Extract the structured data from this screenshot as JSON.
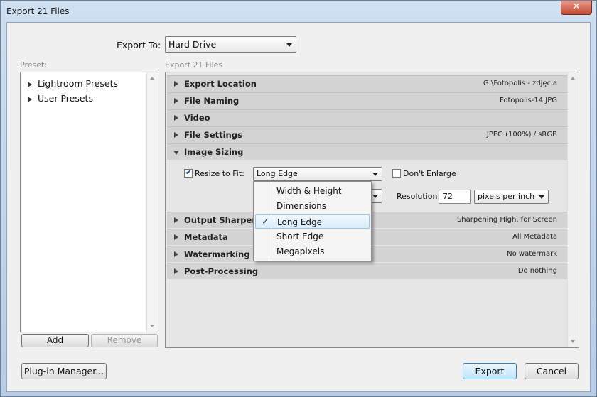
{
  "window": {
    "title": "Export 21 Files",
    "close_glyph": "✕"
  },
  "export_to": {
    "label": "Export To:",
    "value": "Hard Drive"
  },
  "preset": {
    "label": "Preset:",
    "items": [
      {
        "label": "Lightroom Presets"
      },
      {
        "label": "User Presets"
      }
    ],
    "add_label": "Add",
    "remove_label": "Remove"
  },
  "files_header": "Export 21 Files",
  "sections": [
    {
      "name": "Export Location",
      "summary": "G:\\Fotopolis - zdjęcia"
    },
    {
      "name": "File Naming",
      "summary": "Fotopolis-14.JPG"
    },
    {
      "name": "Video",
      "summary": ""
    },
    {
      "name": "File Settings",
      "summary": "JPEG (100%) / sRGB"
    },
    {
      "name": "Image Sizing",
      "summary": ""
    },
    {
      "name": "Output Sharpening",
      "summary": "Sharpening High, for Screen"
    },
    {
      "name": "Metadata",
      "summary": "All Metadata"
    },
    {
      "name": "Watermarking",
      "summary": "No watermark"
    },
    {
      "name": "Post-Processing",
      "summary": "Do nothing"
    }
  ],
  "image_sizing": {
    "resize_label": "Resize to Fit:",
    "resize_checked": true,
    "resize_value": "Long Edge",
    "dont_enlarge_label": "Don't Enlarge",
    "dont_enlarge_checked": false,
    "resolution_label": "Resolution:",
    "resolution_value": "72",
    "resolution_unit": "pixels per inch"
  },
  "resize_dropdown": {
    "options": [
      {
        "label": "Width & Height"
      },
      {
        "label": "Dimensions"
      },
      {
        "label": "Long Edge"
      },
      {
        "label": "Short Edge"
      },
      {
        "label": "Megapixels"
      }
    ],
    "check_glyph": "✓"
  },
  "footer": {
    "plugin_manager_label": "Plug-in Manager...",
    "export_label": "Export",
    "cancel_label": "Cancel"
  }
}
